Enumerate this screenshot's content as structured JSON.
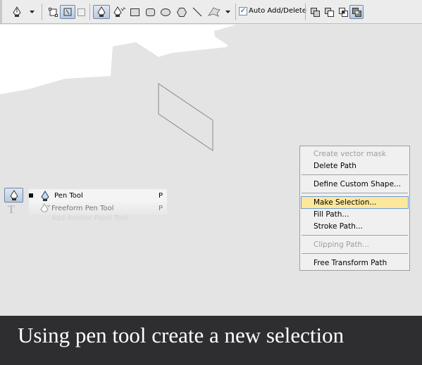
{
  "toolbar": {
    "tool_icon": "pen-icon",
    "modes": [
      "shape-layers-icon",
      "paths-icon",
      "fill-pixels-icon"
    ],
    "selected_mode": "paths",
    "tools": [
      "pen-icon",
      "freeform-pen-icon",
      "rectangle-icon",
      "rounded-rectangle-icon",
      "ellipse-icon",
      "polygon-icon",
      "line-icon",
      "custom-shape-icon"
    ],
    "selected_tool": "pen",
    "auto_add_delete": {
      "label": "Auto Add/Delete",
      "checked": true
    },
    "path_ops": [
      "add-icon",
      "subtract-icon",
      "intersect-icon",
      "exclude-icon"
    ],
    "selected_path_op": "exclude"
  },
  "flyout": {
    "items": [
      {
        "label": "Pen Tool",
        "shortcut": "P",
        "active": true
      },
      {
        "label": "Freeform Pen Tool",
        "shortcut": "P"
      },
      {
        "label": "Add Anchor Point Tool",
        "shortcut": ""
      }
    ]
  },
  "context_menu": {
    "items": [
      {
        "label": "Create vector mask",
        "disabled": true
      },
      {
        "label": "Delete Path"
      },
      {
        "label": "Define Custom Shape..."
      },
      {
        "label": "Make Selection...",
        "highlighted": true
      },
      {
        "label": "Fill Path..."
      },
      {
        "label": "Stroke Path..."
      },
      {
        "label": "Clipping Path...",
        "disabled": true
      },
      {
        "label": "Free Transform Path"
      }
    ]
  },
  "caption": "Using pen tool create a new selection",
  "colors": {
    "canvas": "#e4e4e4",
    "banner": "#2e2e30",
    "highlight": "#fde79a"
  }
}
